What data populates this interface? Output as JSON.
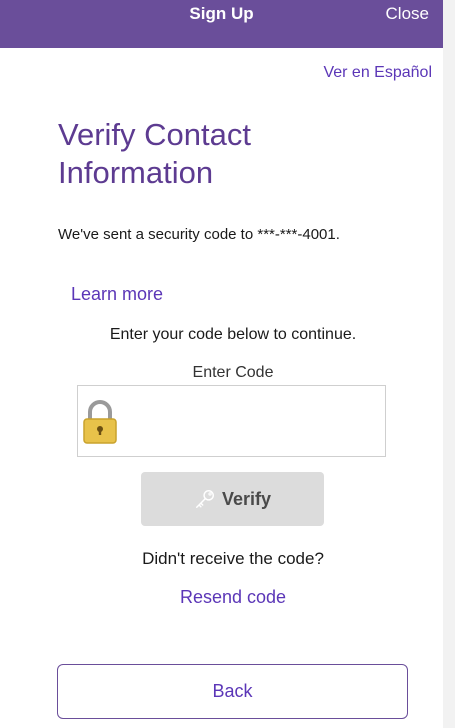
{
  "header": {
    "title": "Sign Up",
    "close_label": "Close",
    "background_color": "#6a4e9a"
  },
  "language_link": "Ver en Español",
  "heading": "Verify Contact Information",
  "description": "We've sent a security code to ***-***-4001.",
  "learn_more": "Learn more",
  "instruction": "Enter your code below to continue.",
  "code_field": {
    "label": "Enter Code",
    "value": "",
    "icon": "lock-icon"
  },
  "verify_button": {
    "label": "Verify",
    "icon": "key-icon",
    "state": "disabled"
  },
  "resend_prompt": "Didn't receive the code?",
  "resend_link": "Resend code",
  "back_button": "Back",
  "accent_color": "#5b36b7"
}
